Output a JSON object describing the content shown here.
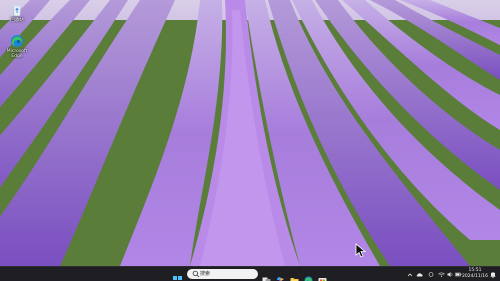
{
  "desktop_icons": [
    {
      "label": "回收站",
      "icon": "recycle-bin-icon"
    },
    {
      "label": "Microsoft Edge",
      "icon": "edge-icon"
    }
  ],
  "taskbar": {
    "search_placeholder": "搜索",
    "apps": [
      "task-view-icon",
      "copilot-icon",
      "file-explorer-icon",
      "edge-icon",
      "store-icon"
    ]
  },
  "tray": {
    "time": "15:51",
    "date": "2024/11/16",
    "icons": [
      "chevron-up-icon",
      "cloud-icon",
      "language-icon",
      "wifi-icon",
      "volume-icon",
      "battery-icon",
      "notification-icon"
    ]
  },
  "colors": {
    "taskbar_bg": "#1f1f23",
    "lavender": "#9b72d6",
    "grass": "#4f7a2e"
  }
}
